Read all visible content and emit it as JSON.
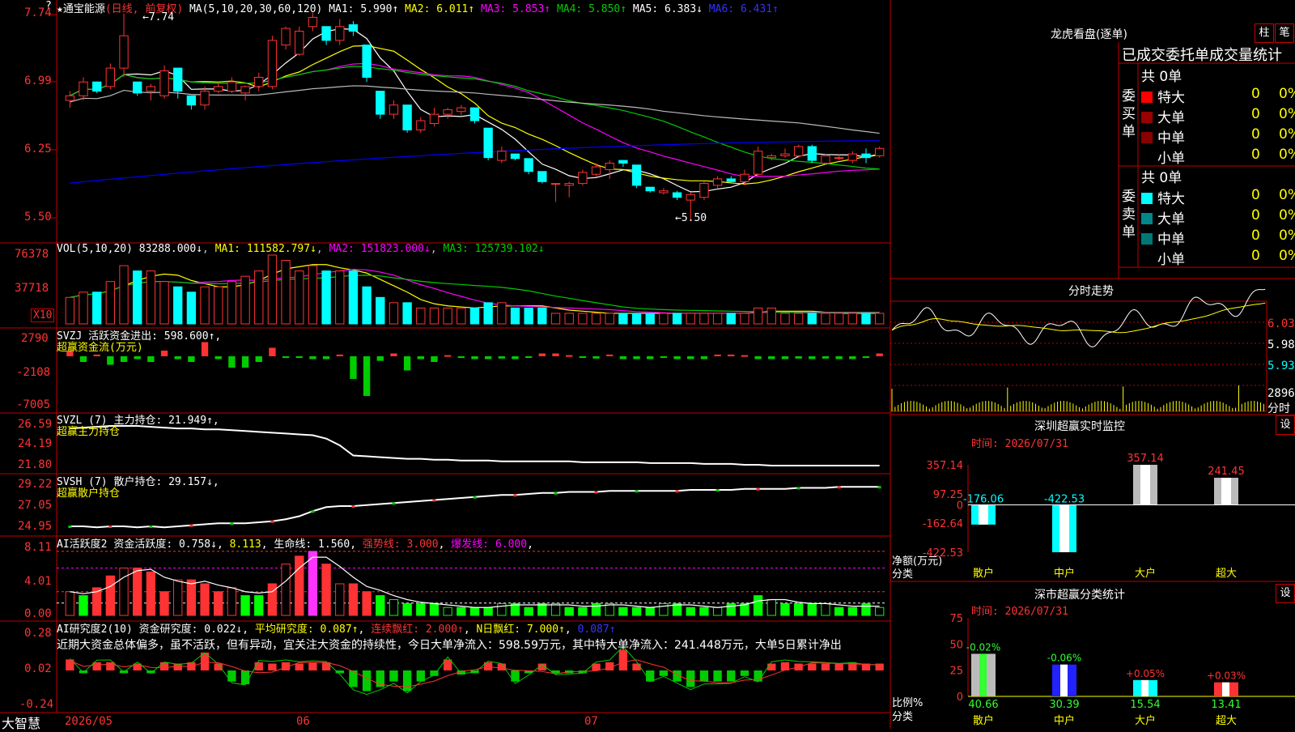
{
  "colors": {
    "up": "#ff3333",
    "down": "#00ffff",
    "bg": "#000000",
    "grid": "#c00000",
    "ma1": "#ffffff",
    "ma2": "#ffff00",
    "ma3": "#ff00ff",
    "ma4": "#00cc00",
    "ma5": "#bbbbbb",
    "ma6": "#0000ff",
    "vol_ma1": "#ffff00",
    "vol_ma2": "#ff00ff",
    "vol_ma3": "#00cc00",
    "gold": "#ffff00"
  },
  "header": {
    "star": "★",
    "stock_name": "通宝能源",
    "period_note": "(日线, 前复权)",
    "ma_label": "MA(5,10,20,30,60,120)",
    "ma": [
      {
        "label": "MA1: 5.990↑"
      },
      {
        "label": "MA2: 6.011↑"
      },
      {
        "label": "MA3: 5.853↑"
      },
      {
        "label": "MA4: 5.850↑"
      },
      {
        "label": "MA5: 6.383↓"
      },
      {
        "label": "MA6: 6.431↑"
      }
    ],
    "close_icon": "?"
  },
  "price_axis": [
    "7.74",
    "6.99",
    "6.25",
    "5.50"
  ],
  "annotations": {
    "high": "7.74",
    "low": "5.50"
  },
  "volume": {
    "title": "VOL(5,10,20)",
    "value": "83288.000↓",
    "ma": [
      {
        "label": "MA1: 111582.797↓"
      },
      {
        "label": "MA2: 151823.000↓"
      },
      {
        "label": "MA3: 125739.102↓"
      }
    ],
    "axis": [
      "76378",
      "37718"
    ],
    "unit": "X10"
  },
  "svzj": {
    "title": "SVZJ",
    "label": "活跃资金进出: 598.600↑,",
    "sub": "超赢资金流(万元)",
    "axis": [
      "2790",
      "-2108",
      "-7005"
    ]
  },
  "svzl": {
    "title": "SVZL (7)",
    "label": "主力持仓: 21.949↑,",
    "sub": "超赢主力持仓",
    "axis": [
      "26.59",
      "24.19",
      "21.80"
    ]
  },
  "svsh": {
    "title": "SVSH (7)",
    "label": "散户持仓: 29.157↓,",
    "sub": "超赢散户持仓",
    "axis": [
      "29.22",
      "27.05",
      "24.95"
    ]
  },
  "ai_act": {
    "title": "AI活跃度2",
    "items": [
      {
        "label": "资金活跃度: 0.758↓"
      },
      {
        "label": "8.113"
      },
      {
        "label": "生命线: 1.560"
      },
      {
        "label": "强势线: 3.000"
      },
      {
        "label": "爆发线: 6.000"
      }
    ],
    "axis": [
      "8.11",
      "4.01",
      "0.00"
    ]
  },
  "ai_res": {
    "title": "AI研究度2(10)",
    "items": [
      {
        "label": "资金研究度: 0.022↓"
      },
      {
        "label": "平均研究度: 0.087↑"
      },
      {
        "label": "连续飘红: 2.000↑"
      },
      {
        "label": "N日飘红: 7.000↑"
      },
      {
        "label": "0.087↑"
      }
    ],
    "text": "近期大资金总体偏多，虽不活跃，但有异动，宜关注大资金的持续性，今日大单净流入：598.59万元，其中特大单净流入：241.448万元，大单5日累计净出",
    "axis": [
      "0.28",
      "0.02",
      "-0.24"
    ]
  },
  "footer": {
    "brand": "大智慧",
    "dates": [
      "2026/05",
      "06",
      "07"
    ]
  },
  "lhb": {
    "title": "龙虎看盘(逐单)",
    "btn1": "柱",
    "btn2": "笔",
    "heading": "已成交委托单成交量统计",
    "buy": {
      "side": "委买单",
      "total": "共 0单",
      "rows": [
        {
          "name": "特大",
          "count": "0",
          "pct": "0%"
        },
        {
          "name": "大单",
          "count": "0",
          "pct": "0%"
        },
        {
          "name": "中单",
          "count": "0",
          "pct": "0%"
        },
        {
          "name": "小单",
          "count": "0",
          "pct": "0%"
        }
      ]
    },
    "sell": {
      "side": "委卖单",
      "total": "共 0单",
      "rows": [
        {
          "name": "特大",
          "count": "0",
          "pct": "0%"
        },
        {
          "name": "大单",
          "count": "0",
          "pct": "0%"
        },
        {
          "name": "中单",
          "count": "0",
          "pct": "0%"
        },
        {
          "name": "小单",
          "count": "0",
          "pct": "0%"
        }
      ]
    }
  },
  "fenshi": {
    "title": "分时走势",
    "axis": [
      "6.03",
      "5.98",
      "5.93"
    ],
    "vol": "2896",
    "vol_unit": "分时"
  },
  "sz_monitor": {
    "title": "深圳超赢实时监控",
    "btn": "设",
    "time": "时间: 2026/07/31",
    "ylabel": "净额(万元)",
    "xlabel": "分类",
    "axis": [
      "357.14",
      "97.25",
      "0",
      "-162.64",
      "-422.53"
    ]
  },
  "sz_class": {
    "title": "深市超赢分类统计",
    "btn": "设",
    "time": "时间: 2026/07/31",
    "ylabel": "比例%",
    "xlabel": "分类",
    "axis": [
      "75",
      "50",
      "25",
      "0"
    ]
  },
  "chart_data": [
    {
      "type": "candlestick",
      "name": "main",
      "ylim": [
        5.3,
        7.8
      ],
      "candles": [
        [
          6.8,
          6.9,
          6.72,
          6.85
        ],
        [
          6.85,
          7.05,
          6.8,
          7.0
        ],
        [
          7.0,
          7.0,
          6.88,
          6.9
        ],
        [
          6.95,
          7.2,
          6.92,
          7.15
        ],
        [
          7.15,
          7.74,
          7.05,
          7.5
        ],
        [
          7.0,
          7.0,
          6.85,
          6.88
        ],
        [
          6.9,
          6.98,
          6.8,
          6.95
        ],
        [
          6.85,
          7.18,
          6.82,
          7.12
        ],
        [
          7.15,
          7.15,
          6.82,
          6.9
        ],
        [
          6.85,
          6.85,
          6.7,
          6.75
        ],
        [
          6.75,
          6.95,
          6.7,
          6.9
        ],
        [
          6.9,
          6.98,
          6.88,
          6.95
        ],
        [
          6.9,
          7.05,
          6.88,
          7.0
        ],
        [
          6.88,
          6.96,
          6.8,
          6.95
        ],
        [
          6.95,
          7.1,
          6.9,
          7.05
        ],
        [
          6.95,
          7.5,
          6.92,
          7.45
        ],
        [
          7.4,
          7.6,
          7.35,
          7.58
        ],
        [
          7.3,
          7.6,
          7.28,
          7.55
        ],
        [
          7.6,
          7.75,
          7.55,
          7.7
        ],
        [
          7.6,
          7.6,
          7.4,
          7.45
        ],
        [
          7.45,
          7.68,
          7.4,
          7.6
        ],
        [
          7.62,
          7.66,
          7.5,
          7.55
        ],
        [
          7.4,
          7.4,
          7.0,
          7.05
        ],
        [
          6.9,
          6.9,
          6.6,
          6.65
        ],
        [
          6.65,
          6.8,
          6.6,
          6.75
        ],
        [
          6.75,
          6.75,
          6.45,
          6.48
        ],
        [
          6.48,
          6.62,
          6.45,
          6.58
        ],
        [
          6.55,
          6.72,
          6.52,
          6.65
        ],
        [
          6.65,
          6.72,
          6.6,
          6.7
        ],
        [
          6.68,
          6.75,
          6.64,
          6.72
        ],
        [
          6.72,
          6.72,
          6.55,
          6.58
        ],
        [
          6.5,
          6.5,
          6.15,
          6.18
        ],
        [
          6.15,
          6.3,
          6.12,
          6.25
        ],
        [
          6.22,
          6.22,
          6.15,
          6.17
        ],
        [
          6.17,
          6.17,
          6.0,
          6.03
        ],
        [
          6.03,
          6.03,
          5.9,
          5.92
        ],
        [
          5.9,
          5.9,
          5.7,
          5.9
        ],
        [
          5.88,
          5.92,
          5.75,
          5.9
        ],
        [
          5.9,
          6.05,
          5.88,
          6.02
        ],
        [
          6.0,
          6.12,
          5.97,
          6.08
        ],
        [
          6.05,
          6.15,
          5.95,
          6.12
        ],
        [
          6.15,
          6.15,
          6.08,
          6.12
        ],
        [
          6.1,
          6.1,
          5.85,
          5.88
        ],
        [
          5.86,
          5.86,
          5.8,
          5.82
        ],
        [
          5.8,
          5.85,
          5.78,
          5.82
        ],
        [
          5.8,
          5.82,
          5.72,
          5.75
        ],
        [
          5.72,
          5.8,
          5.5,
          5.78
        ],
        [
          5.75,
          5.92,
          5.72,
          5.9
        ],
        [
          5.88,
          5.98,
          5.85,
          5.95
        ],
        [
          5.95,
          5.98,
          5.9,
          5.92
        ],
        [
          5.92,
          6.05,
          5.88,
          6.0
        ],
        [
          6.0,
          6.3,
          5.98,
          6.25
        ],
        [
          6.18,
          6.22,
          6.15,
          6.2
        ],
        [
          6.2,
          6.28,
          6.18,
          6.22
        ],
        [
          6.2,
          6.32,
          6.18,
          6.3
        ],
        [
          6.3,
          6.32,
          6.12,
          6.15
        ],
        [
          6.12,
          6.22,
          6.1,
          6.2
        ],
        [
          6.18,
          6.22,
          6.15,
          6.18
        ],
        [
          6.15,
          6.25,
          6.12,
          6.22
        ],
        [
          6.22,
          6.28,
          6.12,
          6.18
        ],
        [
          6.2,
          6.3,
          6.18,
          6.28
        ]
      ]
    },
    {
      "type": "bar",
      "name": "volume",
      "values": [
        5,
        6,
        6,
        8,
        11,
        10,
        10,
        8,
        7,
        6,
        7,
        7,
        8,
        9,
        10,
        13,
        12,
        10,
        11,
        10,
        10,
        10,
        7,
        5,
        4,
        4,
        3,
        3,
        3,
        3,
        3,
        4,
        4,
        3,
        3,
        3,
        2,
        2,
        2,
        2,
        2,
        2,
        2,
        2,
        2,
        2,
        2,
        2,
        2,
        2,
        2,
        3,
        3,
        2,
        2,
        2,
        2,
        2,
        2,
        2,
        2
      ]
    },
    {
      "type": "bar",
      "name": "svzj",
      "values": [
        1,
        -1,
        0.3,
        -1.5,
        -1,
        -0.5,
        -1,
        1,
        -0.5,
        -1,
        2.5,
        -0.5,
        -2,
        -2,
        -1,
        1.5,
        -0.3,
        -0.3,
        -0.5,
        -0.5,
        0.3,
        -4,
        -7,
        -0.8,
        0.5,
        -2.5,
        -0.5,
        -1,
        0.2,
        -0.3,
        -0.5,
        -0.5,
        -0.4,
        -0.5,
        -0.2,
        0.5,
        0.5,
        0.2,
        -0.3,
        -0.4,
        0.3,
        -0.5,
        -0.5,
        -0.5,
        -0.3,
        -0.5,
        -0.5,
        -0.5,
        0.3,
        0.3,
        0.2,
        -0.5,
        -0.5,
        -0.5,
        -0.4,
        -0.5,
        -0.4,
        -0.5,
        -0.5,
        -0.3,
        0.5
      ]
    },
    {
      "type": "line",
      "name": "svzl",
      "values": [
        26.2,
        26.3,
        26.4,
        26.5,
        26.5,
        26.5,
        26.4,
        26.3,
        26.2,
        26.2,
        26.1,
        26.1,
        26.0,
        25.9,
        25.8,
        25.7,
        25.6,
        25.5,
        25.4,
        25.0,
        24.2,
        23.0,
        22.9,
        22.8,
        22.7,
        22.6,
        22.6,
        22.5,
        22.5,
        22.4,
        22.4,
        22.4,
        22.3,
        22.3,
        22.3,
        22.3,
        22.3,
        22.3,
        22.2,
        22.2,
        22.2,
        22.2,
        22.2,
        22.1,
        22.1,
        22.1,
        22.1,
        22.0,
        22.0,
        22.0,
        21.9,
        21.9,
        21.8,
        21.8,
        21.8,
        21.8,
        21.8,
        21.8,
        21.8,
        21.8,
        21.8
      ]
    },
    {
      "type": "line",
      "name": "svsh",
      "values": [
        25.3,
        25.3,
        25.2,
        25.3,
        25.3,
        25.2,
        25.3,
        25.2,
        25.3,
        25.4,
        25.5,
        25.6,
        25.6,
        25.6,
        25.7,
        25.8,
        26.0,
        26.3,
        26.8,
        27.2,
        27.3,
        27.3,
        27.4,
        27.5,
        27.6,
        27.7,
        27.8,
        27.9,
        28.0,
        28.1,
        28.2,
        28.3,
        28.4,
        28.4,
        28.5,
        28.6,
        28.6,
        28.7,
        28.7,
        28.7,
        28.8,
        28.8,
        28.8,
        28.8,
        28.8,
        28.8,
        28.9,
        28.9,
        28.9,
        28.9,
        29.0,
        29.0,
        29.0,
        29.0,
        29.1,
        29.1,
        29.1,
        29.2,
        29.2,
        29.2,
        29.2
      ]
    },
    {
      "type": "bar",
      "name": "ai_activity",
      "values": [
        3.0,
        2.5,
        3.5,
        5.0,
        6.0,
        6.0,
        5.5,
        3.0,
        4.5,
        4.5,
        4.0,
        3.0,
        3.5,
        2.5,
        2.5,
        4.0,
        6.5,
        7.5,
        8.1,
        6.5,
        4.0,
        4.0,
        3.0,
        2.5,
        2.0,
        1.5,
        1.5,
        1.5,
        1.0,
        1.0,
        1.0,
        1.0,
        1.5,
        1.5,
        1.0,
        1.5,
        1.5,
        1.0,
        1.0,
        1.5,
        1.5,
        1.0,
        1.0,
        1.0,
        1.5,
        1.5,
        1.0,
        1.0,
        1.0,
        1.5,
        1.5,
        2.5,
        2.0,
        1.5,
        1.5,
        1.5,
        1.5,
        1.0,
        1.0,
        1.5,
        1.0
      ]
    },
    {
      "type": "bar",
      "name": "ai_research",
      "values": [
        0.08,
        -0.02,
        0.06,
        0.06,
        -0.02,
        0.05,
        -0.02,
        0.06,
        0.05,
        0.06,
        0.13,
        0.05,
        -0.08,
        -0.1,
        0.06,
        0.05,
        0.06,
        0.05,
        0.06,
        0.06,
        -0.02,
        -0.12,
        -0.15,
        -0.12,
        -0.08,
        -0.15,
        -0.08,
        -0.04,
        0.08,
        -0.03,
        -0.02,
        0.06,
        0.05,
        -0.08,
        -0.02,
        0.05,
        -0.02,
        -0.02,
        -0.02,
        0.05,
        0.06,
        0.15,
        0.05,
        -0.08,
        -0.04,
        -0.08,
        -0.12,
        -0.08,
        -0.08,
        -0.08,
        -0.04,
        -0.08,
        0.05,
        0.06,
        0.05,
        0.05,
        0.05,
        0.05,
        0.06,
        0.05,
        0.05
      ]
    },
    {
      "type": "bar",
      "name": "sz_monitor",
      "categories": [
        "散户",
        "中户",
        "大户",
        "超大"
      ],
      "values": [
        -176.06,
        -422.53,
        357.14,
        241.45
      ],
      "ylim": [
        -422.53,
        357.14
      ]
    },
    {
      "type": "bar",
      "name": "sz_class",
      "categories": [
        "散户",
        "中户",
        "大户",
        "超大"
      ],
      "values": [
        40.66,
        30.39,
        15.54,
        13.41
      ],
      "changes": [
        "-0.02%",
        "-0.06%",
        "+0.05%",
        "+0.03%"
      ],
      "ylim": [
        0,
        75
      ]
    }
  ]
}
